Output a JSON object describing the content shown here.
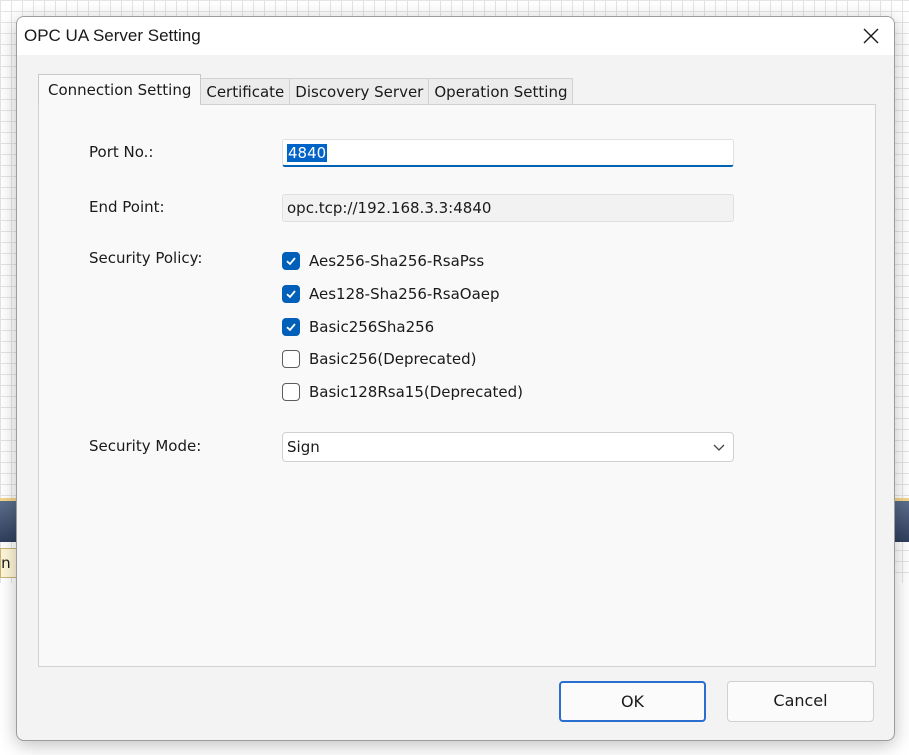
{
  "background": {
    "cell_text": "in"
  },
  "dialog": {
    "title": "OPC UA Server Setting",
    "tabs": [
      {
        "label": "Connection Setting",
        "active": true
      },
      {
        "label": "Certificate",
        "active": false
      },
      {
        "label": "Discovery Server",
        "active": false
      },
      {
        "label": "Operation Setting",
        "active": false
      }
    ],
    "port": {
      "label": "Port No.:",
      "value": "4840"
    },
    "endpoint": {
      "label": "End Point:",
      "value": "opc.tcp://192.168.3.3:4840"
    },
    "security_policy": {
      "label": "Security Policy:",
      "options": [
        {
          "label": "Aes256-Sha256-RsaPss",
          "checked": true
        },
        {
          "label": "Aes128-Sha256-RsaOaep",
          "checked": true
        },
        {
          "label": "Basic256Sha256",
          "checked": true
        },
        {
          "label": "Basic256(Deprecated)",
          "checked": false
        },
        {
          "label": "Basic128Rsa15(Deprecated)",
          "checked": false
        }
      ]
    },
    "security_mode": {
      "label": "Security Mode:",
      "selected": "Sign"
    },
    "buttons": {
      "ok": "OK",
      "cancel": "Cancel"
    },
    "colors": {
      "accent": "#005fb8",
      "selection": "#0063c7"
    }
  }
}
